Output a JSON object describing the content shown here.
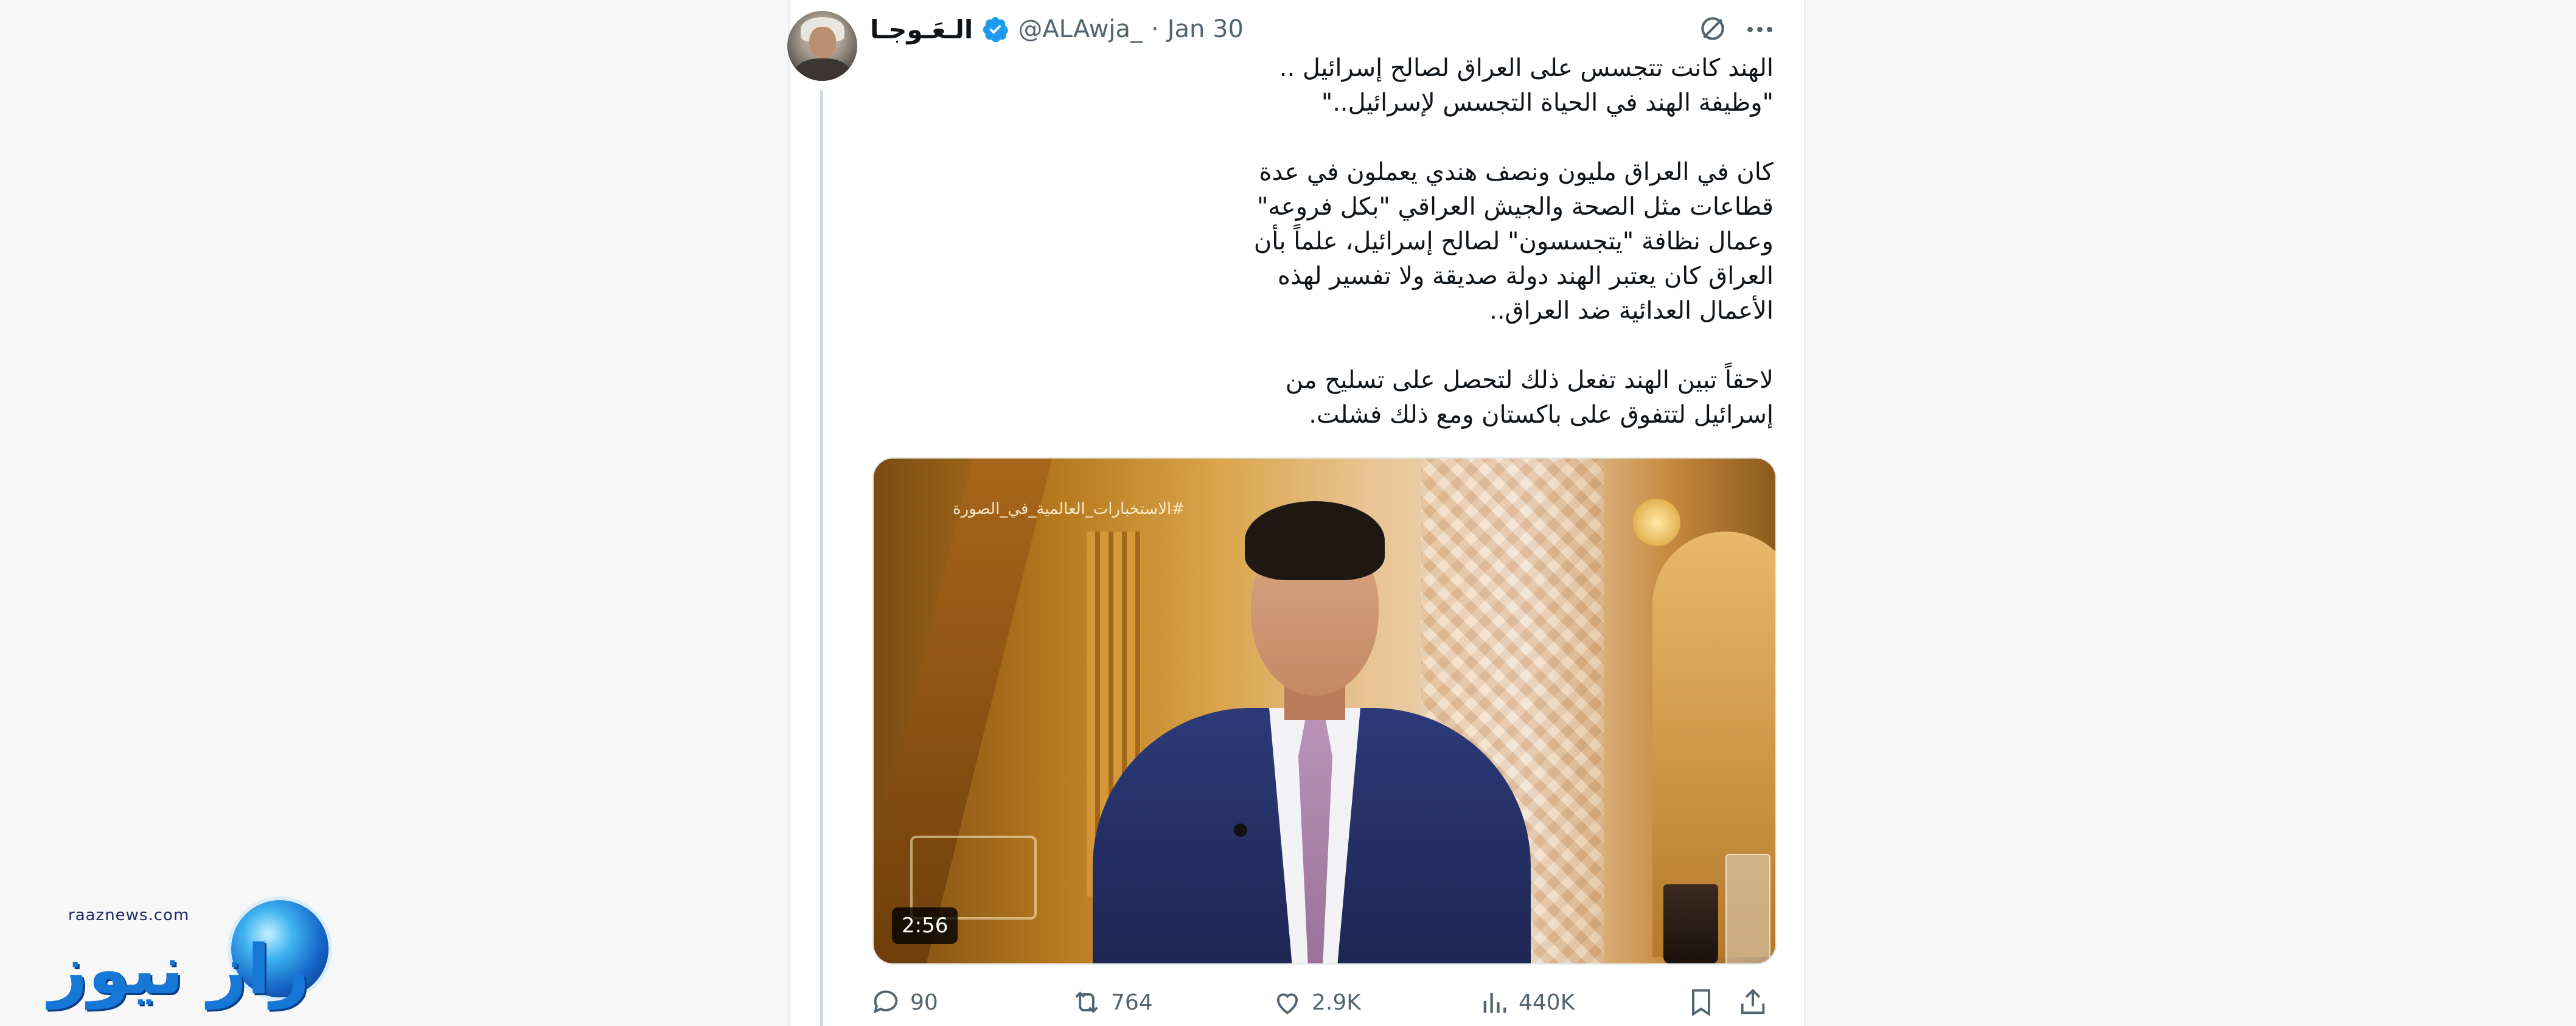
{
  "tweet": {
    "author": {
      "display_name": "الـعَـوجـا",
      "handle": "@ALAwja_",
      "separator": "·",
      "date": "Jan 30"
    },
    "text_paragraphs": [
      [
        "الهند كانت تتجسس على العراق لصالح إسرائيل ..",
        "\"وظيفة الهند في الحياة التجسس لإسرائيل..\""
      ],
      [
        "كان في العراق مليون ونصف هندي يعملون في عدة",
        "قطاعات مثل الصحة والجيش العراقي \"بكل فروعه\"",
        "وعمال نظافة \"يتجسسون\" لصالح إسرائيل، علماً بأن",
        "العراق كان يعتبر الهند دولة صديقة ولا تفسير لهذه",
        "الأعمال العدائية ضد العراق.."
      ],
      [
        "لاحقاً تبين الهند تفعل ذلك لتحصل على تسليح من",
        "إسرائيل لتتفوق على باكستان ومع ذلك فشلت."
      ]
    ],
    "video": {
      "duration": "2:56",
      "overlay_hashtag": "#الاستخبارات_العالمية_في_الصورة"
    },
    "actions": {
      "replies": "90",
      "reposts": "764",
      "likes": "2.9K",
      "views": "440K"
    }
  },
  "watermark": {
    "url": "raaznews.com",
    "word": "راز نيوز"
  },
  "colors": {
    "text_primary": "#0f1419",
    "text_secondary": "#536471",
    "verified_blue": "#1d9bf0",
    "watermark_blue": "#1677d6"
  },
  "icons": [
    "verified-badge-icon",
    "grok-icon",
    "more-icon",
    "reply-icon",
    "repost-icon",
    "like-icon",
    "views-icon",
    "bookmark-icon",
    "share-icon"
  ]
}
